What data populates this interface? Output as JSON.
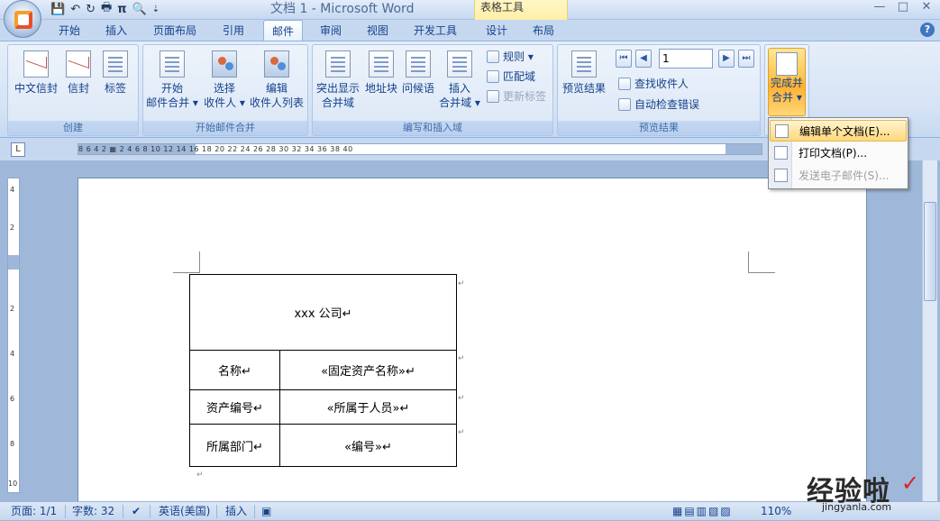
{
  "window": {
    "title": "文档 1 - Microsoft Word",
    "context_tab": "表格工具",
    "controls": [
      "—",
      "□",
      "✕"
    ]
  },
  "qat": {
    "save": "💾",
    "undo": "↶",
    "redo": "↻",
    "print": "🖶",
    "pi": "π",
    "preview": "🔍",
    "more": "⇣"
  },
  "tabs": [
    {
      "label": "开始"
    },
    {
      "label": "插入"
    },
    {
      "label": "页面布局"
    },
    {
      "label": "引用"
    },
    {
      "label": "邮件",
      "active": true
    },
    {
      "label": "审阅"
    },
    {
      "label": "视图"
    },
    {
      "label": "开发工具"
    },
    {
      "label": "设计"
    },
    {
      "label": "布局"
    }
  ],
  "help": "?",
  "ribbon": {
    "groups": {
      "create": {
        "title": "创建",
        "buttons": [
          "中文信封",
          "信封",
          "标签"
        ]
      },
      "start_merge": {
        "title": "开始邮件合并",
        "buttons": [
          {
            "line1": "开始",
            "line2": "邮件合并 ▾"
          },
          {
            "line1": "选择",
            "line2": "收件人 ▾"
          },
          {
            "line1": "编辑",
            "line2": "收件人列表"
          }
        ]
      },
      "write_insert": {
        "title": "编写和插入域",
        "buttons": [
          {
            "line1": "突出显示",
            "line2": "合并域"
          },
          {
            "line1": "地址块",
            "line2": ""
          },
          {
            "line1": "问候语",
            "line2": ""
          },
          {
            "line1": "插入",
            "line2": "合并域 ▾"
          }
        ],
        "small": [
          "规则 ▾",
          "匹配域",
          "更新标签"
        ]
      },
      "preview": {
        "title": "预览结果",
        "button": "预览结果",
        "record": "1",
        "small": [
          "查找收件人",
          "自动检查错误"
        ],
        "nav": [
          "⏮",
          "◀",
          "▶",
          "⏭"
        ]
      },
      "finish": {
        "line1": "完成并",
        "line2": "合并 ▾"
      }
    }
  },
  "dropdown": {
    "items": [
      {
        "label": "编辑单个文档(E)..."
      },
      {
        "label": "打印文档(P)..."
      },
      {
        "label": "发送电子邮件(S)..."
      }
    ]
  },
  "rulers": {
    "corner": "L",
    "horizontal": "8  6  4  2  ▦  2  4  6  8  10  12  14  16  18  20  22  24  26  28  30  32  34  36  38  40",
    "vertical": [
      "4",
      "2",
      "",
      "2",
      "4",
      "6",
      "8",
      "10"
    ]
  },
  "document": {
    "table": [
      [
        "xxx 公司↵"
      ],
      [
        "名称↵",
        "«固定资产名称»↵"
      ],
      [
        "资产编号↵",
        "«所属于人员»↵"
      ],
      [
        "所属部门↵",
        "«编号»↵"
      ]
    ],
    "para_mark": "↵"
  },
  "statusbar": {
    "page": "页面: 1/1",
    "words": "字数: 32",
    "language": "英语(美国)",
    "mode": "插入",
    "zoom": "110%"
  },
  "watermark": {
    "text": "经验啦",
    "url": "jingyanla.com",
    "check": "✓"
  }
}
